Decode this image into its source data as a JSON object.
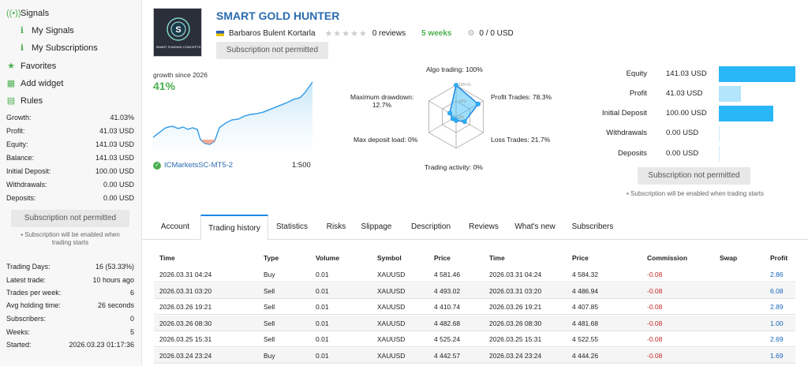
{
  "sidebar": {
    "nav": [
      {
        "label": "Signals",
        "icon": "signal-icon"
      },
      {
        "label": "My Signals",
        "icon": "my-signals-icon"
      },
      {
        "label": "My Subscriptions",
        "icon": "subscriptions-icon"
      },
      {
        "label": "Favorites",
        "icon": "favorites-icon"
      },
      {
        "label": "Add widget",
        "icon": "widget-icon"
      },
      {
        "label": "Rules",
        "icon": "rules-icon"
      }
    ],
    "stats": [
      {
        "label": "Growth:",
        "value": "41.03%"
      },
      {
        "label": "Profit:",
        "value": "41.03 USD"
      },
      {
        "label": "Equity:",
        "value": "141.03 USD"
      },
      {
        "label": "Balance:",
        "value": "141.03 USD"
      },
      {
        "label": "Initial Deposit:",
        "value": "100.00 USD"
      },
      {
        "label": "Withdrawals:",
        "value": "0.00 USD"
      },
      {
        "label": "Deposits:",
        "value": "0.00 USD"
      }
    ],
    "subscribe_label": "Subscription not permitted",
    "subscribe_note": "Subscription will be enabled when trading starts",
    "stats2": [
      {
        "label": "Trading Days:",
        "value": "16 (53.33%)"
      },
      {
        "label": "Latest trade:",
        "value": "10 hours ago"
      },
      {
        "label": "Trades per week:",
        "value": "6"
      },
      {
        "label": "Avg holding time:",
        "value": "26 seconds"
      },
      {
        "label": "Subscribers:",
        "value": "0"
      },
      {
        "label": "Weeks:",
        "value": "5"
      },
      {
        "label": "Started:",
        "value": "2026.03.23 01:17:36"
      }
    ]
  },
  "header": {
    "title": "SMART GOLD HUNTER",
    "logo_text": "SMART FUNDING CONCEPTS",
    "author": "Barbaros Bulent Kortarla",
    "reviews": "0 reviews",
    "rating": 0,
    "weeks": "5 weeks",
    "subscribers": "0 / 0 USD",
    "subscribe_label": "Subscription not permitted"
  },
  "growth": {
    "caption": "growth since 2026",
    "value": "41%",
    "broker": "ICMarketsSC-MT5-2",
    "leverage": "1:500"
  },
  "radar": {
    "algo": "Algo trading: 100%",
    "profit_trades": "Profit Trades: 78.3%",
    "loss_trades": "Loss Trades: 21.7%",
    "trading_activity": "Trading activity: 0%",
    "max_deposit_load": "Max deposit load: 0%",
    "max_drawdown": "Maximum drawdown:",
    "max_drawdown_value": "12.7%",
    "ring_100": "100+%",
    "ring_50": "50%",
    "ring_0": "0%",
    "values": [
      1.0,
      0.783,
      0.217,
      0.0,
      0.0,
      0.127
    ]
  },
  "equity": {
    "rows": [
      {
        "label": "Equity",
        "value": "141.03 USD",
        "amount": 141.03,
        "color": "#29b6f6"
      },
      {
        "label": "Profit",
        "value": "41.03 USD",
        "amount": 41.03,
        "color": "#b3e5fc"
      },
      {
        "label": "Initial Deposit",
        "value": "100.00 USD",
        "amount": 100.0,
        "color": "#29b6f6"
      },
      {
        "label": "Withdrawals",
        "value": "0.00 USD",
        "amount": 0,
        "color": "#29b6f6"
      },
      {
        "label": "Deposits",
        "value": "0.00 USD",
        "amount": 0,
        "color": "#29b6f6"
      }
    ],
    "max": 141.03,
    "subscribe_label": "Subscription not permitted",
    "subscribe_note": "Subscription will be enabled when trading starts"
  },
  "tabs": [
    "Account",
    "Trading history",
    "Statistics",
    "Risks",
    "Slippage",
    "Description",
    "Reviews",
    "What's new",
    "Subscribers"
  ],
  "active_tab": 1,
  "table": {
    "headers": [
      "Time",
      "Type",
      "Volume",
      "Symbol",
      "Price",
      "Time",
      "Price",
      "Commission",
      "Swap",
      "Profit"
    ],
    "rows": [
      [
        "2026.03.31 04:24",
        "Buy",
        "0.01",
        "XAUUSD",
        "4 581.46",
        "2026.03.31 04:24",
        "4 584.32",
        "-0.08",
        "",
        "2.86"
      ],
      [
        "2026.03.31 03:20",
        "Sell",
        "0.01",
        "XAUUSD",
        "4 493.02",
        "2026.03.31 03:20",
        "4 486.94",
        "-0.08",
        "",
        "6.08"
      ],
      [
        "2026.03.26 19:21",
        "Sell",
        "0.01",
        "XAUUSD",
        "4 410.74",
        "2026.03.26 19:21",
        "4 407.85",
        "-0.08",
        "",
        "2.89"
      ],
      [
        "2026.03.26 08:30",
        "Sell",
        "0.01",
        "XAUUSD",
        "4 482.68",
        "2026.03.26 08:30",
        "4 481.68",
        "-0.08",
        "",
        "1.00"
      ],
      [
        "2026.03.25 15:31",
        "Sell",
        "0.01",
        "XAUUSD",
        "4 525.24",
        "2026.03.25 15:31",
        "4 522.55",
        "-0.08",
        "",
        "2.69"
      ],
      [
        "2026.03.24 23:24",
        "Buy",
        "0.01",
        "XAUUSD",
        "4 442.57",
        "2026.03.24 23:24",
        "4 444.26",
        "-0.08",
        "",
        "1.69"
      ]
    ]
  },
  "colors": {
    "accent": "#1e88e5",
    "positive": "#4caf50",
    "negative": "#c62828",
    "profit": "#1565c0"
  }
}
